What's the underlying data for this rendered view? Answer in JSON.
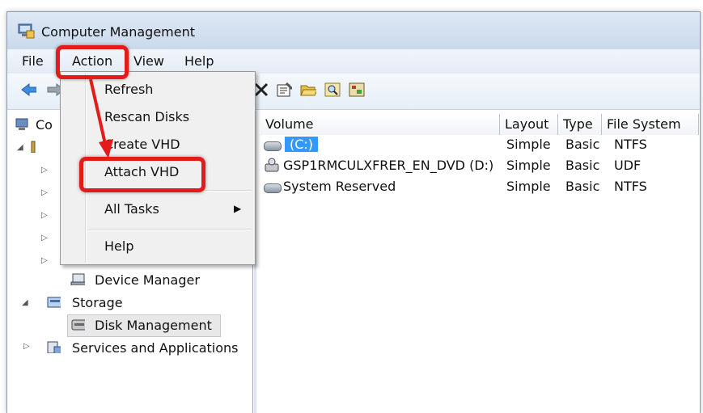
{
  "window": {
    "title": "Computer Management"
  },
  "menu": [
    "File",
    "Action",
    "View",
    "Help"
  ],
  "toolbar_icons": [
    "back-arrow-icon",
    "forward-arrow-icon",
    "delete-icon",
    "properties-icon",
    "open-folder-icon",
    "search-icon",
    "settings-icon"
  ],
  "tree": {
    "root_label_partial": "Co",
    "items": [
      {
        "label": "Device Manager"
      },
      {
        "label": "Storage"
      },
      {
        "label": "Disk Management"
      },
      {
        "label": "Services and Applications"
      }
    ]
  },
  "columns": [
    "Volume",
    "Layout",
    "Type",
    "File System"
  ],
  "volumes": [
    {
      "volume": "(C:)",
      "layout": "Simple",
      "type": "Basic",
      "fs": "NTFS"
    },
    {
      "volume": "GSP1RMCULXFRER_EN_DVD (D:)",
      "layout": "Simple",
      "type": "Basic",
      "fs": "UDF"
    },
    {
      "volume": "System Reserved",
      "layout": "Simple",
      "type": "Basic",
      "fs": "NTFS"
    }
  ],
  "context_menu": {
    "refresh": "Refresh",
    "rescan": "Rescan Disks",
    "create_vhd": "Create VHD",
    "attach_vhd": "Attach VHD",
    "all_tasks": "All Tasks",
    "help": "Help"
  },
  "colors": {
    "highlight": "#e41b1b",
    "selection": "#3399ff"
  }
}
